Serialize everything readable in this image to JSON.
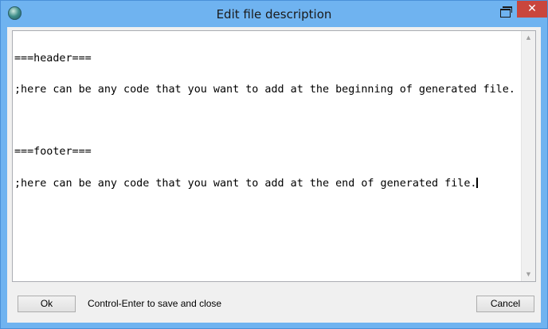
{
  "window": {
    "title": "Edit file description",
    "close_glyph": "✕",
    "app_icon": "globe-icon",
    "restore_icon": "restore-icon"
  },
  "editor": {
    "lines": [
      "===header===",
      ";here can be any code that you want to add at the beginning of generated file.",
      "",
      "===footer===",
      ";here can be any code that you want to add at the end of generated file."
    ],
    "scroll_up_glyph": "▲",
    "scroll_down_glyph": "▼"
  },
  "footer": {
    "ok_label": "Ok",
    "hint": "Control-Enter to save and close",
    "cancel_label": "Cancel"
  },
  "colors": {
    "titlebar": "#6fb3f0",
    "close_button": "#c9463d",
    "client_bg": "#f0f0f0"
  }
}
